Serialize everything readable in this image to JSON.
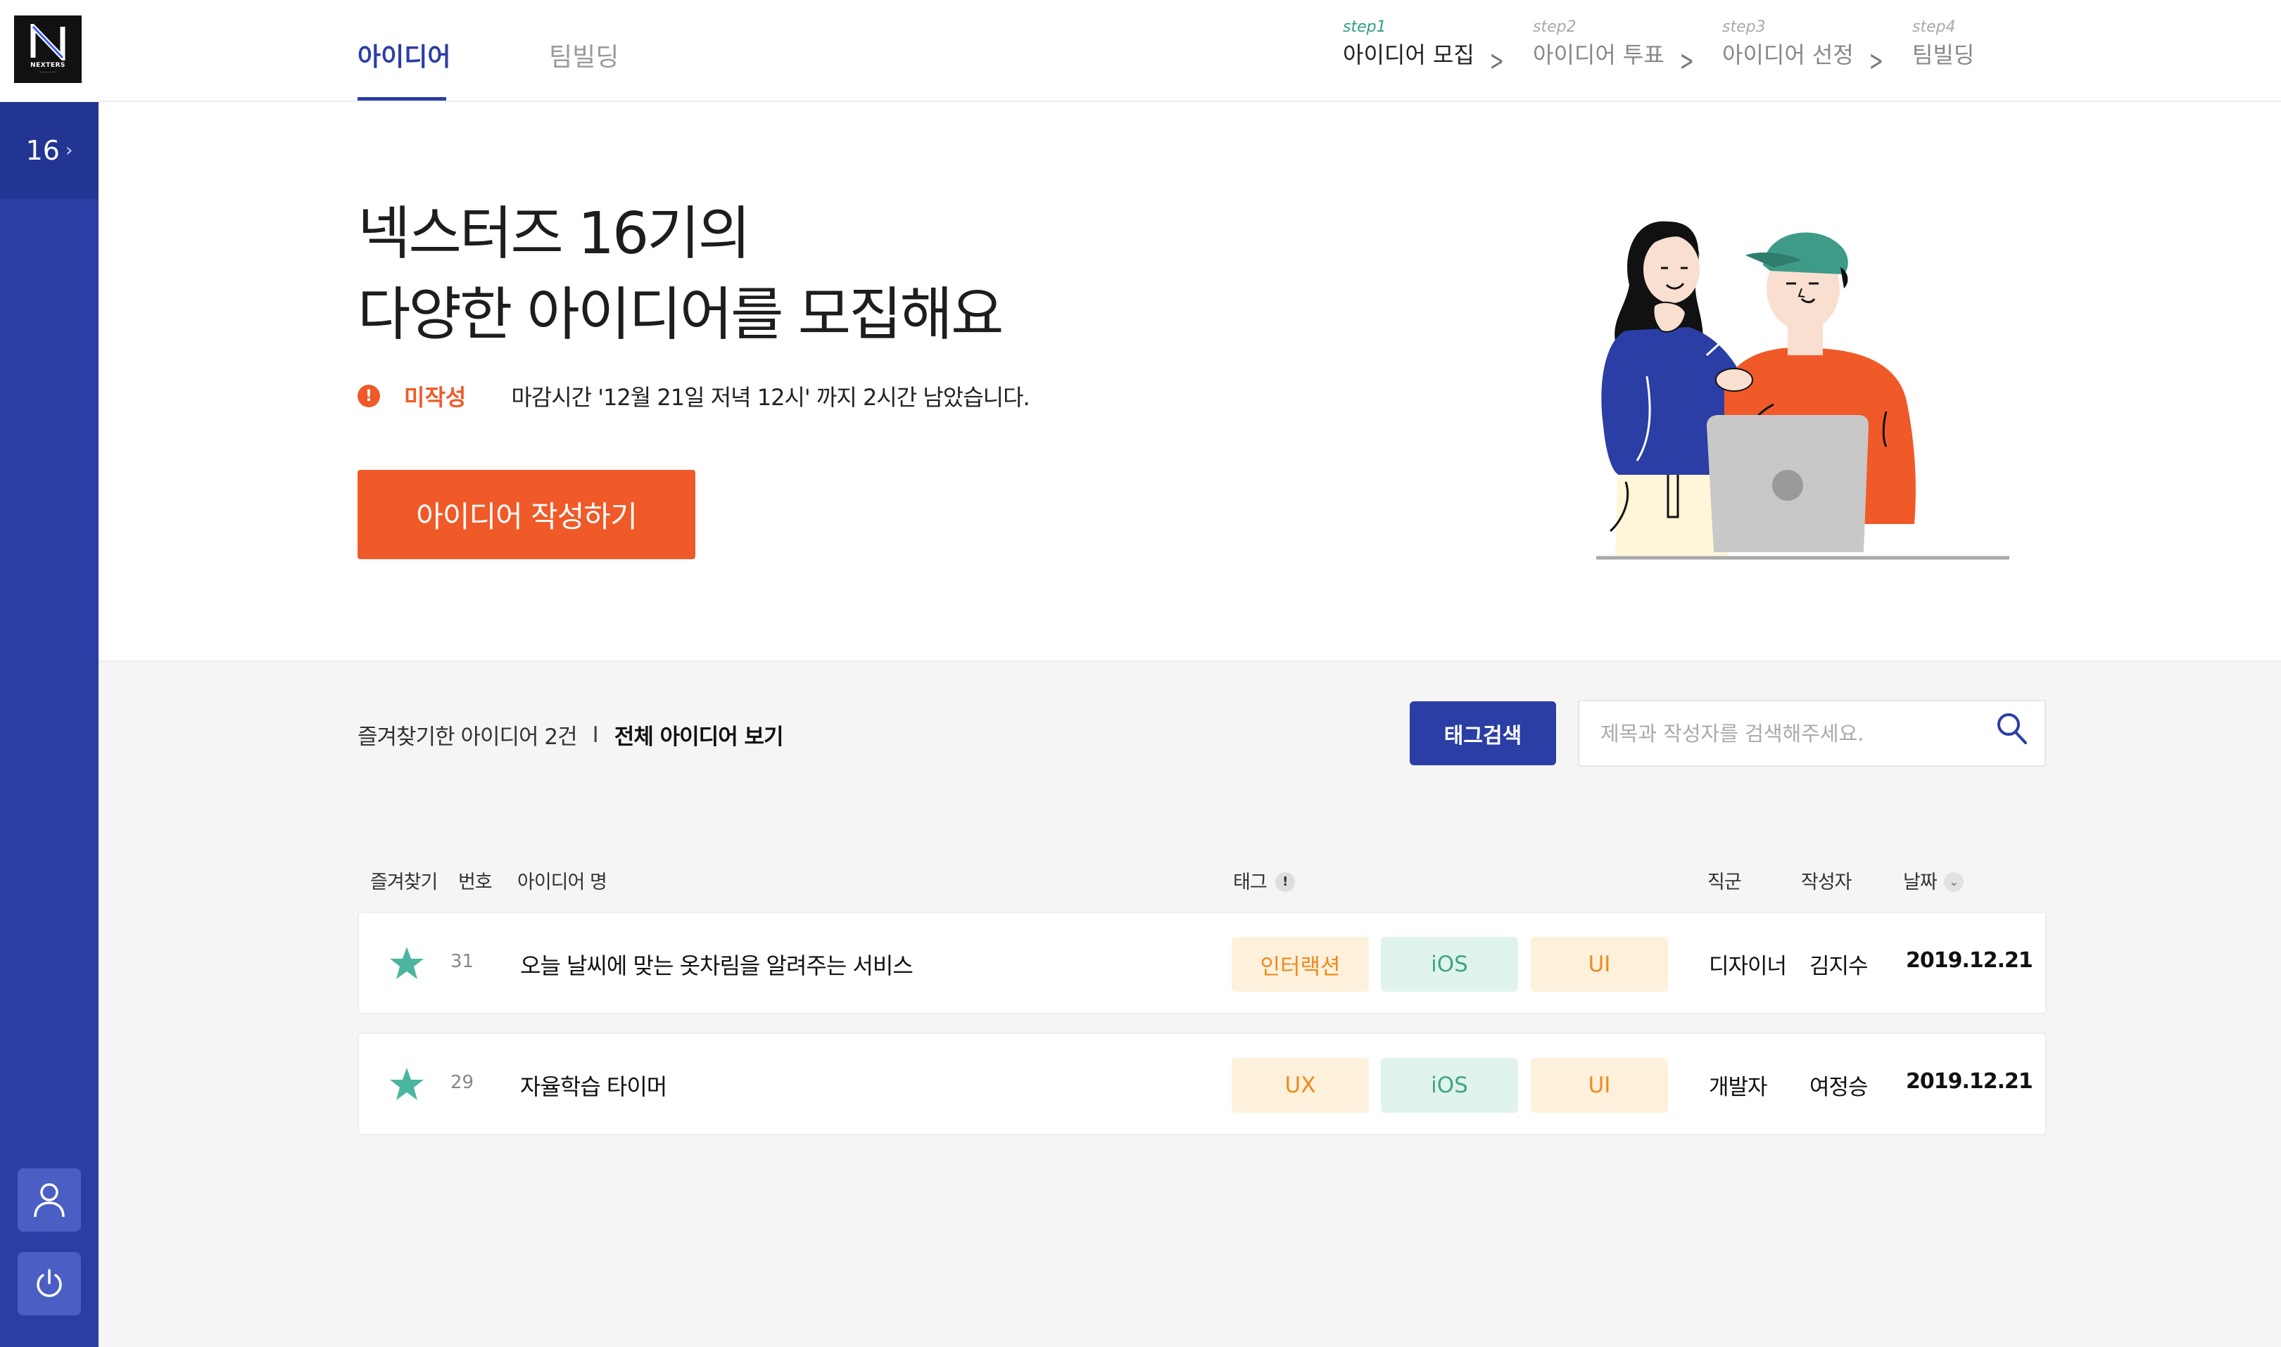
{
  "sidebar": {
    "logo_text": "NEXTERS",
    "generation": "16",
    "generation_chevron": "›",
    "icons": [
      "user-icon",
      "power-icon"
    ]
  },
  "nav": {
    "tabs": [
      {
        "label": "아이디어",
        "active": true
      },
      {
        "label": "팀빌딩",
        "active": false
      }
    ],
    "steps": [
      {
        "no": "step1",
        "name": "아이디어 모집",
        "current": true
      },
      {
        "no": "step2",
        "name": "아이디어 투표",
        "current": false
      },
      {
        "no": "step3",
        "name": "아이디어 선정",
        "current": false
      },
      {
        "no": "step4",
        "name": "팀빌딩",
        "current": false
      }
    ],
    "step_separator": ">"
  },
  "hero": {
    "title_line1": "넥스터즈 16기의",
    "title_line2": "다양한 아이디어를 모집해요",
    "status_icon": "!",
    "status_label": "미작성",
    "deadline_text": "마감시간 '12월 21일 저녁 12시' 까지 2시간 남았습니다.",
    "cta_label": "아이디어 작성하기"
  },
  "list": {
    "favorites_label": "즐겨찾기한 아이디어 2건",
    "separator": "I",
    "view_all_label": "전체 아이디어 보기",
    "tag_search_label": "태그검색",
    "search_placeholder": "제목과 작성자를 검색해주세요.",
    "search_value": "",
    "columns": {
      "favorite": "즐겨찾기",
      "number": "번호",
      "idea_name": "아이디어 명",
      "tag": "태그",
      "tag_info": "!",
      "role": "직군",
      "author": "작성자",
      "date": "날짜",
      "date_sort": "⌄"
    },
    "rows": [
      {
        "favorited": true,
        "number": "31",
        "title": "오늘 날씨에 맞는 옷차림을 알려주는 서비스",
        "tags": [
          "인터랙션",
          "iOS",
          "UI"
        ],
        "role": "디자이너",
        "author": "김지수",
        "date": "2019.12.21"
      },
      {
        "favorited": true,
        "number": "29",
        "title": "자율학습 타이머",
        "tags": [
          "UX",
          "iOS",
          "UI"
        ],
        "role": "개발자",
        "author": "여정승",
        "date": "2019.12.21"
      }
    ]
  },
  "colors": {
    "brand_blue": "#2b3ea5",
    "accent_orange": "#f05a28",
    "tag_orange_bg": "#fdf1dc",
    "tag_orange_fg": "#f0891d",
    "tag_green_bg": "#e1f3ed",
    "tag_green_fg": "#3fa588",
    "star": "#4bb5a0"
  }
}
